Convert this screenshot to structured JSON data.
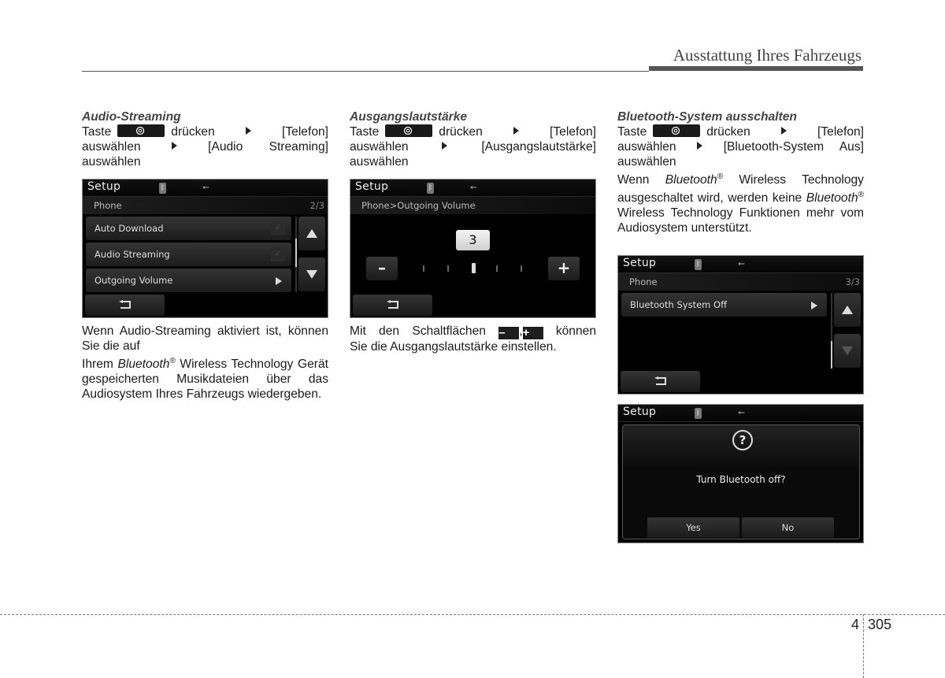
{
  "header": {
    "running_title": "Ausstattung Ihres Fahrzeugs"
  },
  "common": {
    "taste": "Taste",
    "druecken": "drücken",
    "telefon": "[Telefon]",
    "auswaehlen": "auswählen",
    "setup_key_icon": "gear-icon",
    "bluetooth_word": "Bluetooth",
    "registered": "®"
  },
  "sections": [
    {
      "title": "Audio-Streaming",
      "menu_item": "[Audio Streaming]",
      "body_lines": {
        "p1": "Wenn Audio-Streaming aktiviert ist, können Sie die auf",
        "p2_pre": "Ihrem",
        "p2_post": "Wireless Technology Gerät gespeicherten Musikdateien über das Audiosystem Ihres Fahrzeugs wiedergeben."
      }
    },
    {
      "title": "Ausgangslautstärke",
      "menu_item": "[Ausgangslautstärke]",
      "body": {
        "pre": "Mit den Schaltflächen",
        "minus": "–",
        "comma": ",",
        "plus": "+",
        "post_1": "können",
        "post_2": "Sie die Ausgangslautstärke einstellen."
      }
    },
    {
      "title": "Bluetooth-System ausschalten",
      "menu_item": "[Bluetooth-System Aus]",
      "body": {
        "w1": "Wenn",
        "w2": "Wireless Technology ausgeschaltet wird, werden keine",
        "w3": "Wireless Technology Funktionen mehr vom Audiosystem unterstützt."
      }
    }
  ],
  "screens": {
    "setup_title": "Setup",
    "screen1": {
      "subtitle": "Phone",
      "page": "2/3",
      "items": [
        {
          "label": "Auto Download",
          "control": "checkbox",
          "checked": true
        },
        {
          "label": "Audio Streaming",
          "control": "checkbox",
          "checked": true
        },
        {
          "label": "Outgoing Volume",
          "control": "arrow"
        }
      ]
    },
    "screen2": {
      "subtitle": "Phone>Outgoing Volume",
      "volume_value": "3",
      "volume_level": 3,
      "volume_steps": 5,
      "minus_label": "–",
      "plus_label": "+"
    },
    "screen3": {
      "subtitle": "Phone",
      "page": "3/3",
      "items": [
        {
          "label": "Bluetooth System Off",
          "control": "arrow"
        }
      ]
    },
    "screen4": {
      "question_icon": "?",
      "message": "Turn Bluetooth off?",
      "yes": "Yes",
      "no": "No"
    }
  },
  "footer": {
    "chapter": "4",
    "page": "305"
  }
}
